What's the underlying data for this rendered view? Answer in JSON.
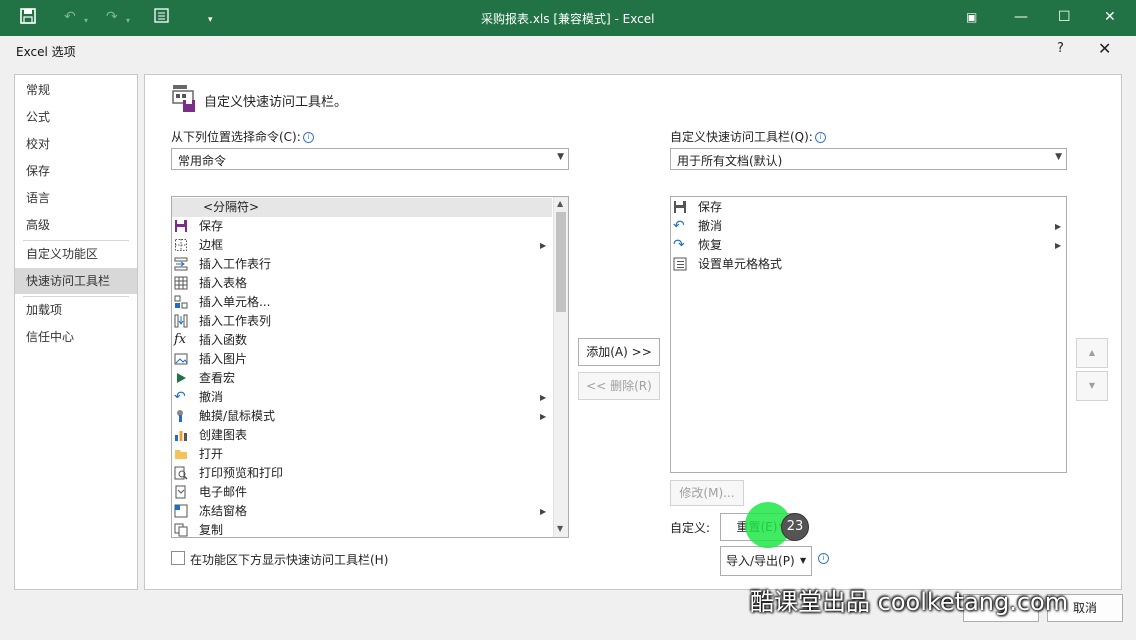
{
  "window": {
    "title": "采购报表.xls  [兼容模式] - Excel",
    "accent": "#217346"
  },
  "dialog": {
    "title": "Excel 选项",
    "help": "?",
    "close": "✕"
  },
  "nav": {
    "items": [
      {
        "label": "常规"
      },
      {
        "label": "公式"
      },
      {
        "label": "校对"
      },
      {
        "label": "保存"
      },
      {
        "label": "语言"
      },
      {
        "label": "高级"
      },
      {
        "label": "自定义功能区"
      },
      {
        "label": "快速访问工具栏",
        "selected": true
      },
      {
        "label": "加载项"
      },
      {
        "label": "信任中心"
      }
    ]
  },
  "main": {
    "heading": "自定义快速访问工具栏。",
    "choose_label": "从下列位置选择命令(C):",
    "choose_value": "常用命令",
    "customize_label": "自定义快速访问工具栏(Q):",
    "customize_value": "用于所有文档(默认)",
    "commands": [
      {
        "label": "<分隔符>",
        "icon": "separator-icon"
      },
      {
        "label": "保存",
        "icon": "save-icon"
      },
      {
        "label": "边框",
        "icon": "border-icon",
        "submenu": true
      },
      {
        "label": "插入工作表行",
        "icon": "insert-row-icon"
      },
      {
        "label": "插入表格",
        "icon": "insert-table-icon"
      },
      {
        "label": "插入单元格...",
        "icon": "insert-cell-icon"
      },
      {
        "label": "插入工作表列",
        "icon": "insert-column-icon"
      },
      {
        "label": "插入函数",
        "icon": "function-icon"
      },
      {
        "label": "插入图片",
        "icon": "picture-icon"
      },
      {
        "label": "查看宏",
        "icon": "macro-icon"
      },
      {
        "label": "撤消",
        "icon": "undo-icon",
        "submenu": true
      },
      {
        "label": "触摸/鼠标模式",
        "icon": "touch-icon",
        "submenu": true
      },
      {
        "label": "创建图表",
        "icon": "chart-icon"
      },
      {
        "label": "打开",
        "icon": "open-icon"
      },
      {
        "label": "打印预览和打印",
        "icon": "print-preview-icon"
      },
      {
        "label": "电子邮件",
        "icon": "email-icon"
      },
      {
        "label": "冻结窗格",
        "icon": "freeze-icon",
        "submenu": true
      },
      {
        "label": "复制",
        "icon": "copy-icon"
      }
    ],
    "toolbar_items": [
      {
        "label": "保存",
        "icon": "save-icon"
      },
      {
        "label": "撤消",
        "icon": "undo-icon",
        "submenu": true
      },
      {
        "label": "恢复",
        "icon": "redo-icon",
        "submenu": true
      },
      {
        "label": "设置单元格格式",
        "icon": "format-cells-icon"
      }
    ],
    "add_button": "添加(A) >>",
    "remove_button": "<< 删除(R)",
    "modify_button": "修改(M)...",
    "customize_label2": "自定义:",
    "reset_button": "重置(E)",
    "import_export_button": "导入/导出(P)",
    "show_below_ribbon": "在功能区下方显示快速访问工具栏(H)",
    "up_arrow": "▲",
    "down_arrow": "▼"
  },
  "footer": {
    "cancel_button": "取消"
  },
  "overlay": {
    "step_badge": "23",
    "watermark": "酷课堂出品 coolketang.com"
  }
}
